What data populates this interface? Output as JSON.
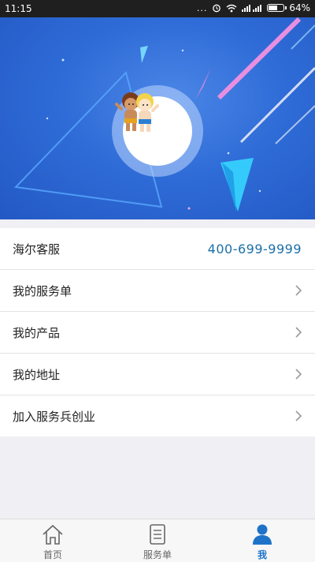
{
  "status_bar": {
    "time": "11:15",
    "indicators": "...",
    "battery_percent": "64%",
    "battery_level": 0.64
  },
  "profile": {
    "avatar_icon": "cartoon-mascot-avatar"
  },
  "menu": {
    "items": [
      {
        "label": "海尔客服",
        "value": "400-699-9999",
        "icon": ""
      },
      {
        "label": "我的服务单",
        "icon": "chevron-right-icon"
      },
      {
        "label": "我的产品",
        "icon": "chevron-right-icon"
      },
      {
        "label": "我的地址",
        "icon": "chevron-right-icon"
      },
      {
        "label": "加入服务兵创业",
        "icon": "chevron-right-icon"
      }
    ]
  },
  "tabbar": {
    "tabs": [
      {
        "label": "首页",
        "icon": "home-icon",
        "active": false
      },
      {
        "label": "服务单",
        "icon": "document-icon",
        "active": false
      },
      {
        "label": "我",
        "icon": "person-icon",
        "active": true
      }
    ]
  },
  "colors": {
    "accent": "#1e73c9",
    "hero_blue": "#2f6cd7",
    "phone_text": "#1c6fa8"
  }
}
